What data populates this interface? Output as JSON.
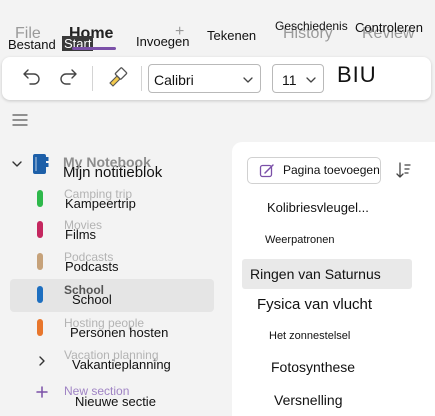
{
  "ribbon": {
    "ghost_tabs": [
      {
        "id": "file",
        "text": "File"
      },
      {
        "id": "home",
        "text": "Home"
      },
      {
        "id": "insert",
        "text": "+"
      },
      {
        "id": "history",
        "text": "History"
      },
      {
        "id": "review",
        "text": "Review"
      }
    ],
    "tabs": [
      {
        "id": "bestand",
        "label": "Bestand"
      },
      {
        "id": "start",
        "label": "Start",
        "active": true
      },
      {
        "id": "invoegen",
        "label": "Invoegen"
      },
      {
        "id": "tekenen",
        "label": "Tekenen"
      },
      {
        "id": "geschiedenis",
        "label": "Geschiedenis"
      },
      {
        "id": "controleren",
        "label": "Controleren"
      }
    ]
  },
  "toolbar": {
    "font_name": "Calibri",
    "font_size": "11",
    "format_buttons": "BIU",
    "icons": [
      "undo-icon",
      "redo-icon",
      "format-painter-icon",
      "chevron-down-icon"
    ]
  },
  "nav": {
    "notebook_ghost": "My Notebook",
    "notebook_title": "Mijn notitieblok",
    "sections": [
      {
        "id": "kampeertrip",
        "ghost": "Camping trip",
        "label": "Kampeertrip",
        "color": "#2eb84b"
      },
      {
        "id": "films",
        "ghost": "Movies",
        "label": "Films",
        "color": "#c4275f"
      },
      {
        "id": "podcasts",
        "ghost": "Podcasts",
        "label": "Podcasts",
        "color": "#c6a27a"
      },
      {
        "id": "school",
        "ghost": "School",
        "label": "School",
        "color": "#1e6fc0",
        "selected": true
      },
      {
        "id": "personen-hosten",
        "ghost": "Hosting people",
        "label": "Personen hosten",
        "color": "#e8762c"
      },
      {
        "id": "vakantieplanning",
        "ghost": "Vacation planning",
        "label": "Vakantieplanning",
        "group": true
      }
    ],
    "new_section_ghost": "New section",
    "new_section": "Nieuwe sectie",
    "colors": {
      "accent": "#7b50a8"
    }
  },
  "pages": {
    "add_page_label": "Pagina toevoegen",
    "items": [
      {
        "id": "kolibries",
        "label": "Kolibriesvleugel..."
      },
      {
        "id": "weerpatronen",
        "label": "Weerpatronen"
      },
      {
        "id": "ringen",
        "label": "Ringen van Saturnus",
        "selected": true
      },
      {
        "id": "fysica",
        "label": "Fysica van vlucht"
      },
      {
        "id": "zonnestelsel",
        "label": "Het zonnestelsel"
      },
      {
        "id": "fotosynthese",
        "label": "Fotosynthese"
      },
      {
        "id": "versnelling",
        "label": "Versnelling"
      }
    ]
  }
}
